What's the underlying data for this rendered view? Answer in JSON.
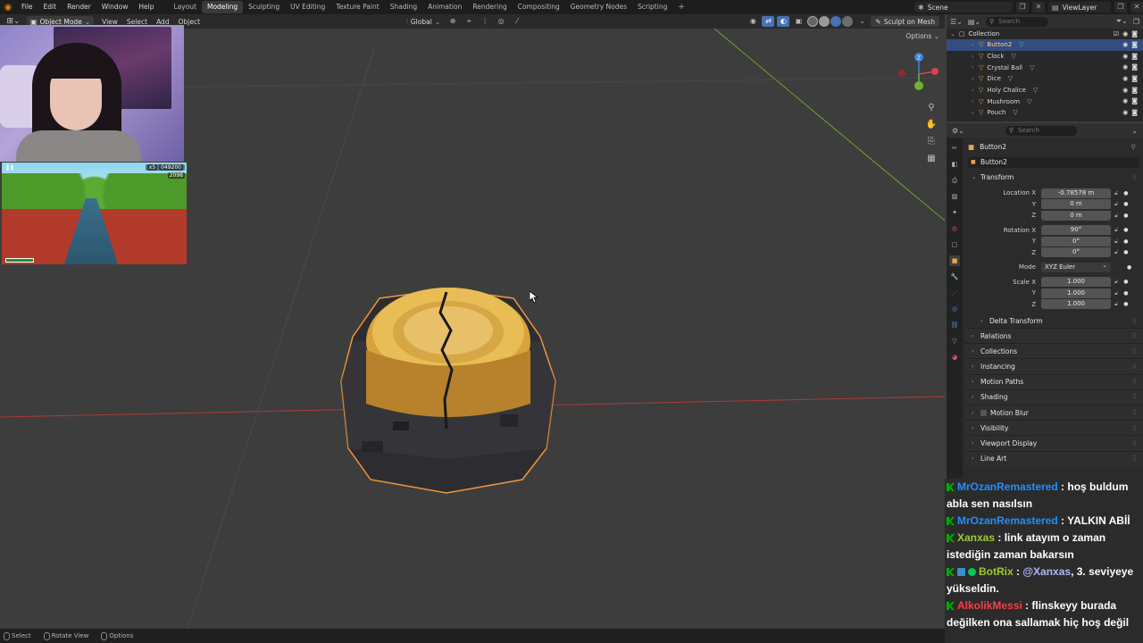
{
  "topbar": {
    "menus": [
      "File",
      "Edit",
      "Render",
      "Window",
      "Help"
    ],
    "workspaces": [
      "Layout",
      "Modeling",
      "Sculpting",
      "UV Editing",
      "Texture Paint",
      "Shading",
      "Animation",
      "Rendering",
      "Compositing",
      "Geometry Nodes",
      "Scripting"
    ],
    "active_workspace": "Modeling",
    "add_tab": "+",
    "scene_label": "Scene",
    "view_layer_label": "ViewLayer"
  },
  "viewport_header": {
    "mode": "Object Mode",
    "menus": [
      "View",
      "Select",
      "Add",
      "Object"
    ],
    "orientation": "Global",
    "sculpt_button": "Sculpt on Mesh"
  },
  "viewport": {
    "options_label": "Options",
    "gizmo": {
      "x_color": "#e0404f",
      "y_color": "#6fb32f",
      "z_color": "#3d84d7",
      "z_label": "Z"
    }
  },
  "stream_overlay": {
    "game_hud": {
      "multiplier": "x5",
      "score": "049200",
      "coins": "2098"
    }
  },
  "outliner": {
    "search_placeholder": "Search",
    "collection_label": "Collection",
    "items": [
      {
        "name": "Button2",
        "selected": true
      },
      {
        "name": "Clock",
        "selected": false
      },
      {
        "name": "Crystal Ball",
        "selected": false
      },
      {
        "name": "Dice",
        "selected": false
      },
      {
        "name": "Holy Chalice",
        "selected": false
      },
      {
        "name": "Mushroom",
        "selected": false
      },
      {
        "name": "Pouch",
        "selected": false
      }
    ]
  },
  "properties": {
    "search_placeholder": "Search",
    "object_title": "Button2",
    "object_name": "Button2",
    "transform_label": "Transform",
    "location": {
      "label": "Location X",
      "x": "-0.78578 m",
      "y": "0 m",
      "z": "0 m"
    },
    "rotation": {
      "label": "Rotation X",
      "x": "90°",
      "y": "0°",
      "z": "0°"
    },
    "mode": {
      "label": "Mode",
      "value": "XYZ Euler"
    },
    "scale": {
      "label": "Scale X",
      "x": "1.000",
      "y": "1.000",
      "z": "1.000"
    },
    "axis_y": "Y",
    "axis_z": "Z",
    "delta_transform": "Delta Transform",
    "panels": [
      "Relations",
      "Collections",
      "Instancing",
      "Motion Paths",
      "Shading",
      "Motion Blur",
      "Visibility",
      "Viewport Display",
      "Line Art"
    ]
  },
  "chat": {
    "messages": [
      {
        "user": "MrOzanRemastered",
        "user_color": "#1e90ff",
        "text": " : hoş buldum abla sen nasılsın",
        "mention": "",
        "after": ""
      },
      {
        "user": "MrOzanRemastered",
        "user_color": "#1e90ff",
        "text": " : YALKIN ABİİ",
        "mention": "",
        "after": ""
      },
      {
        "user": "Xanxas",
        "user_color": "#9acd32",
        "text": " : link atayım o zaman istediğin zaman bakarsın",
        "mention": "",
        "after": ""
      },
      {
        "user": "BotRix",
        "user_color": "#9acd32",
        "text": " : ",
        "mention": "@Xanxas",
        "after": ", 3. seviyeye yükseldin."
      },
      {
        "user": "AlkolikMessi",
        "user_color": "#ff3b4a",
        "text": " : flinskeyy burada değilken ona sallamak hiç hoş değil",
        "mention": "",
        "after": ""
      }
    ]
  },
  "statusbar": {
    "items": [
      "Select",
      "Rotate View",
      "Options"
    ]
  }
}
